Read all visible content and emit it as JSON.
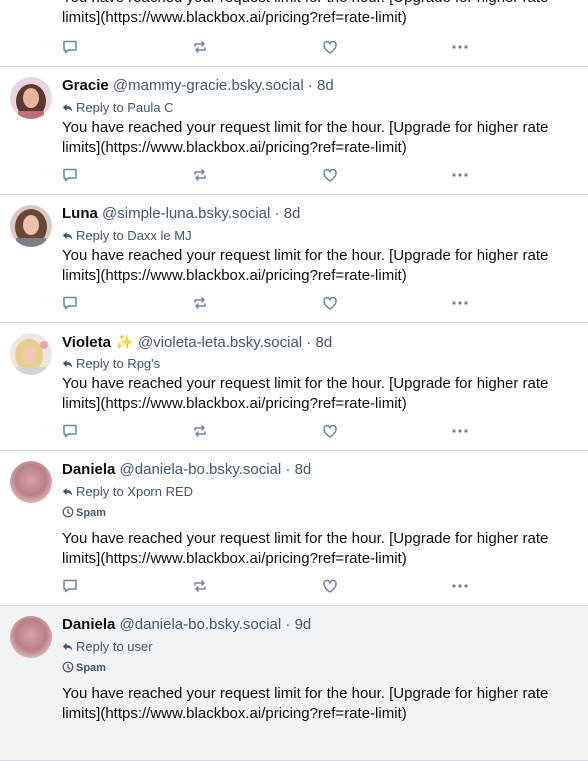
{
  "posts": [
    {
      "name": "",
      "handle": "",
      "time": "",
      "text": "You have reached your request limit for the hour. [Upgrade for higher rate limits](https://www.blackbox.ai/pricing?ref=rate-limit)"
    },
    {
      "name": "Gracie",
      "handle": "@mammy-gracie.bsky.social",
      "time": "8d",
      "reply_to": "Reply to Paula C",
      "text": "You have reached your request limit for the hour. [Upgrade for higher rate limits](https://www.blackbox.ai/pricing?ref=rate-limit)"
    },
    {
      "name": "Luna",
      "handle": "@simple-luna.bsky.social",
      "time": "8d",
      "reply_to": "Reply to Daxx le MJ",
      "text": "You have reached your request limit for the hour. [Upgrade for higher rate limits](https://www.blackbox.ai/pricing?ref=rate-limit)"
    },
    {
      "name": "Violeta",
      "name_emoji": "✨",
      "handle": "@violeta-leta.bsky.social",
      "time": "8d",
      "reply_to": "Reply to Rpg's",
      "text": "You have reached your request limit for the hour. [Upgrade for higher rate limits](https://www.blackbox.ai/pricing?ref=rate-limit)"
    },
    {
      "name": "Daniela",
      "handle": "@daniela-bo.bsky.social",
      "time": "8d",
      "reply_to": "Reply to Xporn RED",
      "label": "Spam",
      "text": "You have reached your request limit for the hour. [Upgrade for higher rate limits](https://www.blackbox.ai/pricing?ref=rate-limit)"
    },
    {
      "name": "Daniela",
      "handle": "@daniela-bo.bsky.social",
      "time": "9d",
      "reply_to": "Reply to user",
      "label": "Spam",
      "text": "You have reached your request limit for the hour. [Upgrade for higher rate limits](https://www.blackbox.ai/pricing?ref=rate-limit)"
    }
  ],
  "separator": " · ",
  "icons": {
    "reply": "chat-bubble-icon",
    "repost": "repost-icon",
    "like": "heart-icon",
    "more": "more-dots-icon",
    "reply_arrow": "reply-arrow-icon",
    "spam": "spam-label-icon"
  },
  "colors": {
    "text": "#0b0f14",
    "muted": "#42576c",
    "icon": "#6f869f",
    "divider": "#d4dbe2",
    "highlight_bg": "#f1f3f5"
  }
}
